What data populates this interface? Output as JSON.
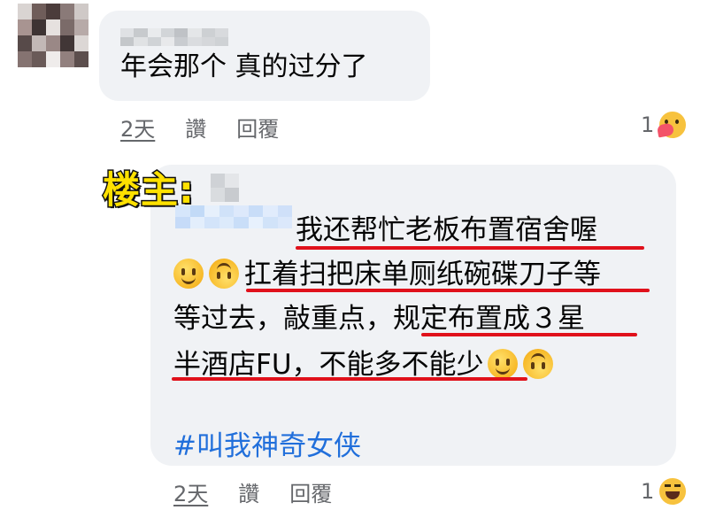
{
  "comment": {
    "text": "年会那个 真的过分了",
    "actions": {
      "time": "2天",
      "like": "讚",
      "reply": "回覆"
    },
    "reaction_count": "1",
    "reaction_icon": "care-icon"
  },
  "reply": {
    "badge": "楼主:",
    "lines": [
      "我还帮忙老板布置宿舍喔",
      "扛着扫把床单厕纸碗碟刀子等",
      "等过去，敲重点，规定布置成３星",
      "半酒店FU，不能多不能少"
    ],
    "hashtag": "#叫我神奇女侠",
    "actions": {
      "time": "2天",
      "like": "讚",
      "reply": "回覆"
    },
    "reaction_count": "1",
    "reaction_icon": "haha-icon"
  },
  "colors": {
    "bubble": "#f0f2f5",
    "underline": "#e0111b",
    "hashtag": "#216fdb",
    "badge": "#ffe100"
  }
}
